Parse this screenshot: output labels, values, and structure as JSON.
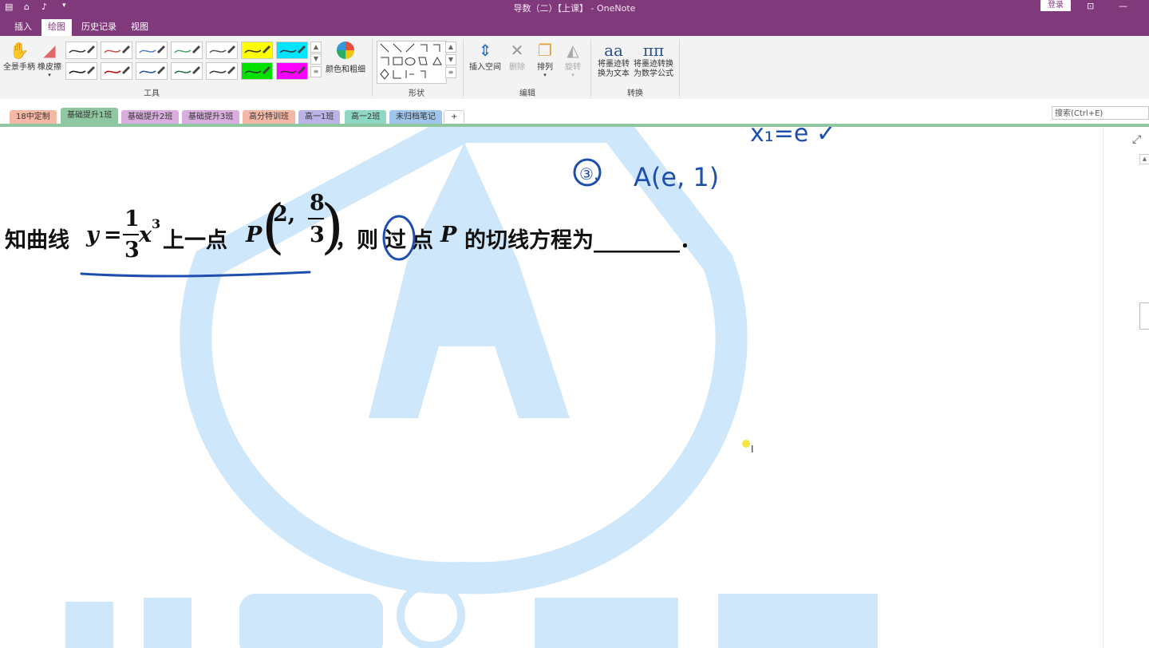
{
  "titlebar": {
    "title": "导数（二）【上课】 - OneNote",
    "login_label": "登录"
  },
  "menu": {
    "tabs": [
      {
        "label": "插入",
        "active": false
      },
      {
        "label": "绘图",
        "active": true
      },
      {
        "label": "历史记录",
        "active": false
      },
      {
        "label": "视图",
        "active": false
      }
    ]
  },
  "ribbon": {
    "pan_label": "全景手柄",
    "eraser_label": "橡皮擦",
    "color_thickness_label": "颜色和粗细",
    "tools_group": "工具",
    "shapes_group": "形状",
    "insert_space_label": "插入空间",
    "delete_label": "删除",
    "arrange_label": "排列",
    "rotate_label": "旋转",
    "edit_group": "编辑",
    "ink_to_text_label": "将墨迹转换为文本",
    "ink_to_math_label": "将墨迹转换为数学公式",
    "convert_group": "转换",
    "pens": [
      {
        "color": "#333333"
      },
      {
        "color": "#c0504d"
      },
      {
        "color": "#4f81bd"
      },
      {
        "color": "#4f9d6a"
      },
      {
        "color": "#555555"
      },
      {
        "color": "#ffff00"
      },
      {
        "color": "#00e5ff"
      },
      {
        "color": "#111111"
      },
      {
        "color": "#c00000"
      },
      {
        "color": "#1f4e9c"
      },
      {
        "color": "#1f6e3a"
      },
      {
        "color": "#333333"
      },
      {
        "color": "#00e000"
      },
      {
        "color": "#ff00ff"
      }
    ]
  },
  "sections": [
    {
      "label": "18中定制",
      "color": "#f4b9a6",
      "active": false
    },
    {
      "label": "基础提升1班",
      "color": "#8fc8a0",
      "active": true
    },
    {
      "label": "基础提升2班",
      "color": "#d9aede",
      "active": false
    },
    {
      "label": "基础提升3班",
      "color": "#d9aede",
      "active": false
    },
    {
      "label": "高分特训班",
      "color": "#f4b9a6",
      "active": false
    },
    {
      "label": "高一1班",
      "color": "#b9b3e6",
      "active": false
    },
    {
      "label": "高一2班",
      "color": "#8fd6c4",
      "active": false
    },
    {
      "label": "未归档笔记",
      "color": "#9fc5ec",
      "active": false
    }
  ],
  "add_section_label": "+",
  "search": {
    "placeholder": "搜索(Ctrl+E)"
  },
  "question": {
    "prefix": "知曲线",
    "y": "y",
    "eq": "=",
    "frac_num": "1",
    "frac_den": "3",
    "x_var": "x",
    "exp": "3",
    "mid": "上一点",
    "point": "P",
    "coord_x": "2,",
    "coord_num": "8",
    "coord_den": "3",
    "after": "，则",
    "guo": "过",
    "after2": "点",
    "point2": "P",
    "tail": "的切线方程为________．"
  },
  "ink": {
    "note_number": "③.",
    "note_point": "A(e, 1)",
    "top_note": "x₁=e ✓"
  },
  "colors": {
    "brand": "#80397b",
    "ink": "#1e4fae",
    "watermark": "#cfe7fb"
  }
}
